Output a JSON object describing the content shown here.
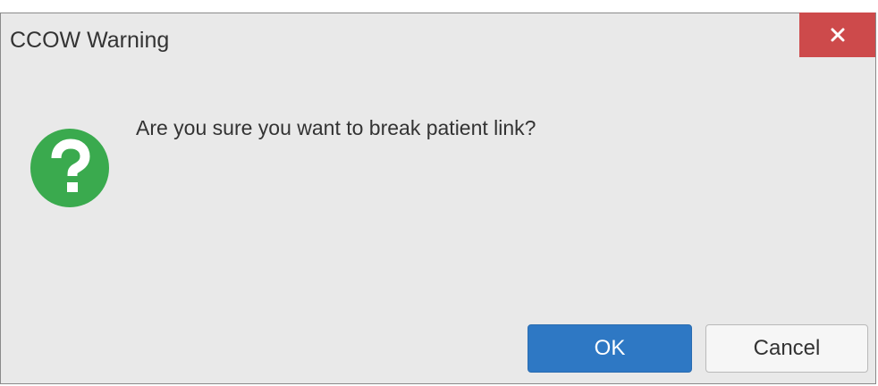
{
  "dialog": {
    "title": "CCOW Warning",
    "close_icon": "close-icon",
    "question_icon": "question-icon",
    "message": "Are you sure you want to break patient link?",
    "buttons": {
      "ok_label": "OK",
      "cancel_label": "Cancel"
    }
  },
  "colors": {
    "close_button": "#cd4a4b",
    "question_icon": "#3aaa4e",
    "ok_button": "#2e78c4",
    "dialog_background": "#e9e9e9"
  }
}
